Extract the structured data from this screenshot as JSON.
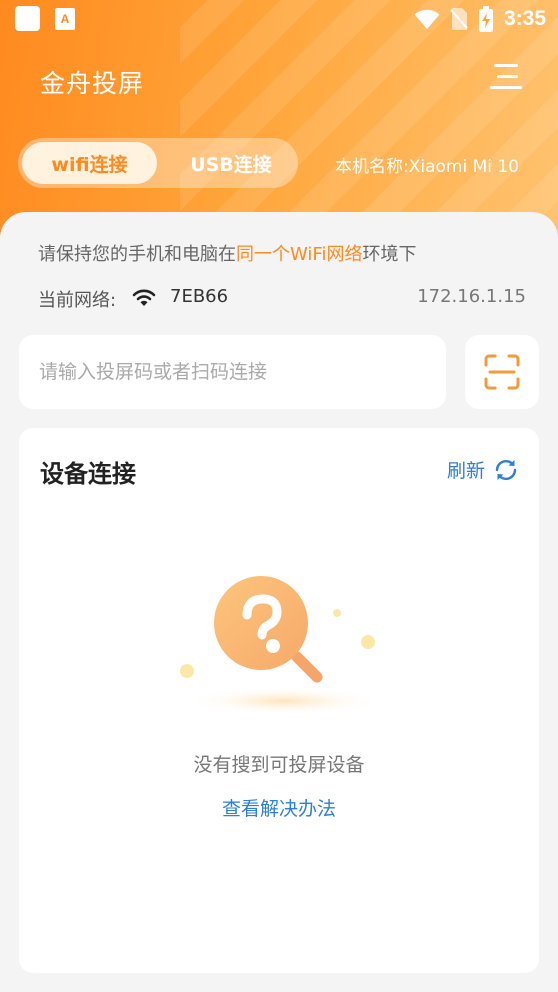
{
  "status_bar": {
    "time": "3:35"
  },
  "header": {
    "app_title": "金舟投屏",
    "tabs": [
      {
        "label": "wifi连接",
        "active": true
      },
      {
        "label": "USB连接",
        "active": false
      }
    ],
    "device_name": "本机名称:Xiaomi  Mi 10"
  },
  "network": {
    "hint_prefix": "请保持您的手机和电脑在",
    "hint_highlight": "同一个WiFi网络",
    "hint_suffix": "环境下",
    "label": "当前网络:",
    "ssid": "7EB66",
    "ip": "172.16.1.15"
  },
  "code_input": {
    "placeholder": "请输入投屏码或者扫码连接",
    "value": ""
  },
  "devices": {
    "title": "设备连接",
    "refresh_label": "刷新",
    "empty_text": "没有搜到可投屏设备",
    "solution_link": "查看解决办法"
  },
  "colors": {
    "accent": "#ff8a1f",
    "link": "#2f7fd6"
  }
}
